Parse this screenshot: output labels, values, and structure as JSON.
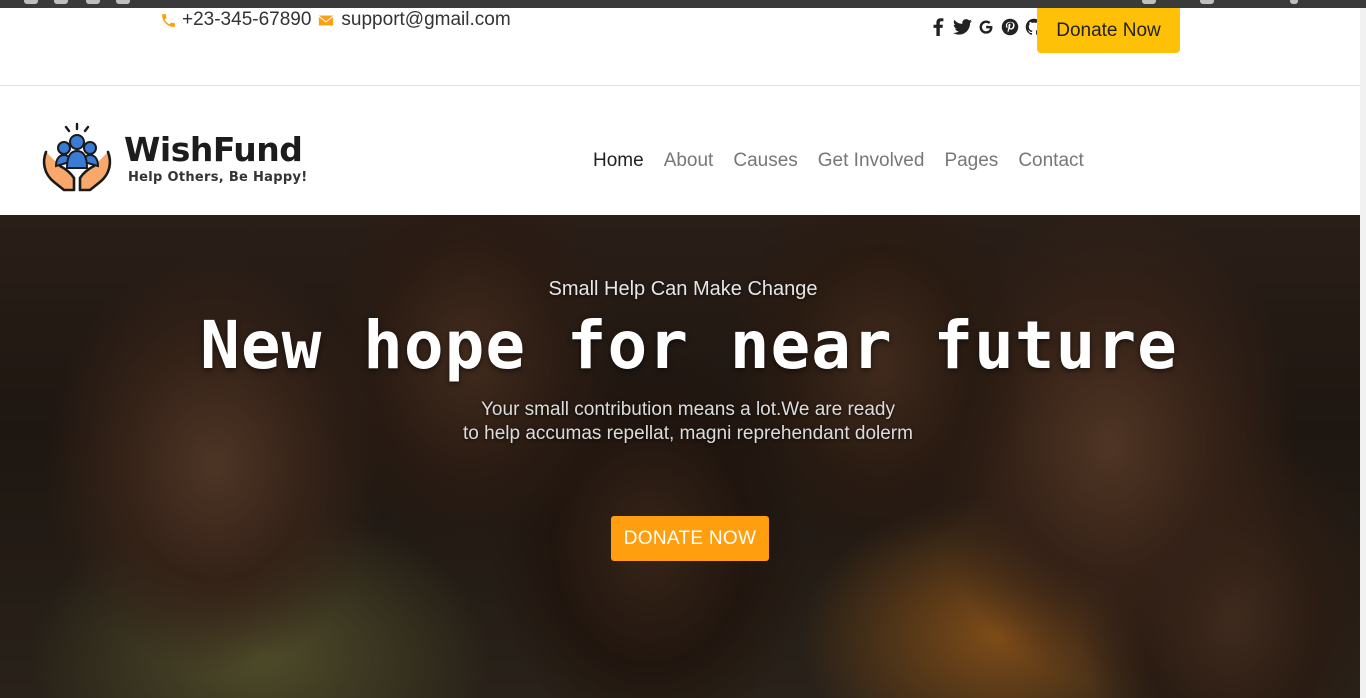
{
  "topbar": {
    "phone": "+23-345-67890",
    "email": "support@gmail.com",
    "social_icons": [
      "facebook-icon",
      "twitter-icon",
      "google-icon",
      "pinterest-icon",
      "github-icon"
    ],
    "donate_label": "Donate Now"
  },
  "header": {
    "brand": "WishFund",
    "tagline": "Help Others, Be Happy!",
    "nav": [
      {
        "label": "Home",
        "active": true
      },
      {
        "label": "About",
        "active": false
      },
      {
        "label": "Causes",
        "active": false
      },
      {
        "label": "Get Involved",
        "active": false
      },
      {
        "label": "Pages",
        "active": false
      },
      {
        "label": "Contact",
        "active": false
      }
    ]
  },
  "hero": {
    "subtitle": "Small Help Can Make Change",
    "title": "New hope for near future",
    "desc_line1": "Your small contribution means a lot.We are ready",
    "desc_line2": "to help accumas repellat, magni reprehendant dolerm",
    "button_label": "DONATE NOW"
  },
  "colors": {
    "accent_yellow": "#ffc107",
    "accent_orange": "#ff9f0f",
    "text_dark": "#222222",
    "nav_muted": "#777777"
  }
}
